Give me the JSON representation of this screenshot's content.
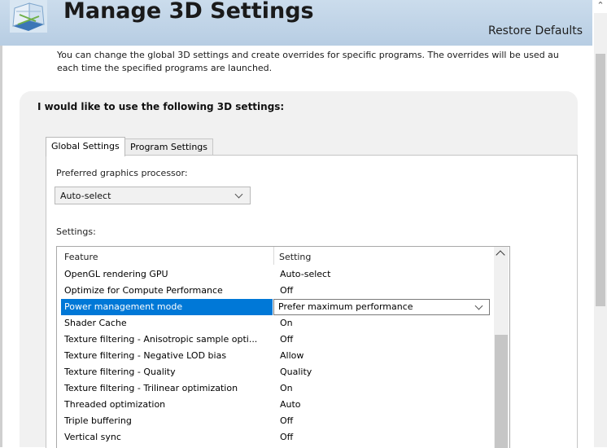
{
  "header": {
    "title": "Manage 3D Settings",
    "restore_defaults": "Restore Defaults",
    "icon": "nvidia-3d-settings-icon"
  },
  "description": {
    "line1": "You can change the global 3D settings and create overrides for specific programs. The overrides will be used au",
    "line2": "each time the specified programs are launched."
  },
  "section": {
    "title": "I would like to use the following 3D settings:"
  },
  "tabs": [
    {
      "label": "Global Settings",
      "active": true
    },
    {
      "label": "Program Settings",
      "active": false
    }
  ],
  "preferred_gpu": {
    "label": "Preferred graphics processor:",
    "value": "Auto-select"
  },
  "settings": {
    "label": "Settings:",
    "columns": [
      "Feature",
      "Setting"
    ],
    "rows": [
      {
        "feature": "OpenGL rendering GPU",
        "setting": "Auto-select"
      },
      {
        "feature": "Optimize for Compute Performance",
        "setting": "Off"
      },
      {
        "feature": "Power management mode",
        "setting": "Prefer maximum performance",
        "selected": true
      },
      {
        "feature": "Shader Cache",
        "setting": "On"
      },
      {
        "feature": "Texture filtering - Anisotropic sample opti...",
        "setting": "Off"
      },
      {
        "feature": "Texture filtering - Negative LOD bias",
        "setting": "Allow"
      },
      {
        "feature": "Texture filtering - Quality",
        "setting": "Quality"
      },
      {
        "feature": "Texture filtering - Trilinear optimization",
        "setting": "On"
      },
      {
        "feature": "Threaded optimization",
        "setting": "Auto"
      },
      {
        "feature": "Triple buffering",
        "setting": "Off"
      },
      {
        "feature": "Vertical sync",
        "setting": "Off"
      }
    ]
  },
  "colors": {
    "selection": "#0078d7",
    "header_bg": "#c2d6ea"
  }
}
